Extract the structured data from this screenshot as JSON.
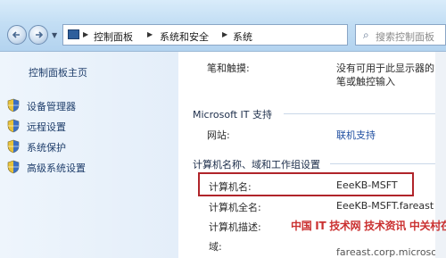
{
  "address": {
    "crumbs": [
      "控制面板",
      "系统和安全",
      "系统"
    ]
  },
  "search": {
    "placeholder": "搜索控制面板"
  },
  "sidebar": {
    "home": "控制面板主页",
    "items": [
      {
        "label": "设备管理器",
        "icon": "shield-icon"
      },
      {
        "label": "远程设置",
        "icon": "shield-icon"
      },
      {
        "label": "系统保护",
        "icon": "shield-icon"
      },
      {
        "label": "高级系统设置",
        "icon": "shield-icon"
      }
    ]
  },
  "main": {
    "pen_label": "笔和触摸:",
    "pen_value_1": "没有可用于此显示器的",
    "pen_value_2": "笔或触控输入",
    "support_title": "Microsoft IT 支持",
    "website_label": "网站:",
    "website_value": "联机支持",
    "name_section_title": "计算机名称、域和工作组设置",
    "computer_name_label": "计算机名:",
    "computer_name_value": "EeeKB-MSFT",
    "full_name_label": "计算机全名:",
    "full_name_value": "EeeKB-MSFT.fareast",
    "description_label": "计算机描述:",
    "domain_label": "域:",
    "domain_value": "fareast.corp.microso"
  },
  "watermark": {
    "text": "中国 IT 技术网 技术资讯 中关村在线"
  },
  "colors": {
    "highlight": "#b0242a",
    "link": "#1f4ea0",
    "accent": "#2f5f9c"
  }
}
